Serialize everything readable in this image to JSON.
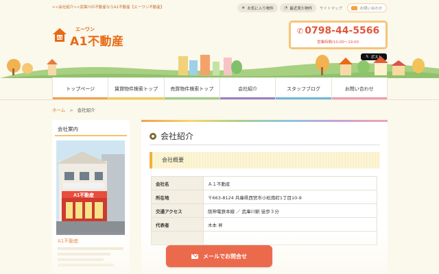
{
  "topbar": {
    "tagline": "<<会社紹介<<武庫川の不動産ならA1不動産【エーワン不動産】",
    "favorites": "お気に入り物件",
    "recent": "最近見た物件",
    "sitemap": "サイトマップ",
    "contact": "お問い合わせ"
  },
  "logo": {
    "kana": "エーワン",
    "name": "A1不動産"
  },
  "phone": {
    "number": "0798-44-5566",
    "hours": "営業時間/10:00～19:00"
  },
  "tweet": "ポスト",
  "nav": [
    {
      "label": "トップページ",
      "color": "#f0a04a"
    },
    {
      "label": "賃貸物件検索トップ",
      "color": "#f3c85a"
    },
    {
      "label": "売買物件検索トップ",
      "color": "#9fcb84"
    },
    {
      "label": "会社紹介",
      "color": "#9a7ec4"
    },
    {
      "label": "スタッフブログ",
      "color": "#6fb6df"
    },
    {
      "label": "お問い合わせ",
      "color": "#ef9bb1"
    }
  ],
  "breadcrumb": {
    "home": "ホーム",
    "sep": ">",
    "current": "会社紹介"
  },
  "sidebar": {
    "title": "会社案内",
    "shop_name": "A1不動産"
  },
  "main": {
    "title": "会社紹介",
    "section": "会社概要",
    "rows": [
      {
        "key": "会社名",
        "value": "Ａ１不動産"
      },
      {
        "key": "所在地",
        "value": "〒663-8124 兵庫県西宮市小松南町1丁目10-9"
      },
      {
        "key": "交通アクセス",
        "value": "阪神電鉄本線 ／ 武庫川駅 徒歩３分"
      },
      {
        "key": "代表者",
        "value": "木本 昇"
      },
      {
        "key": "",
        "value": ""
      }
    ]
  },
  "cta": "メールでお問合せ",
  "colors": {
    "accent": "#e86a14",
    "cta": "#ec6a4c",
    "background": "#fbf8ec"
  }
}
